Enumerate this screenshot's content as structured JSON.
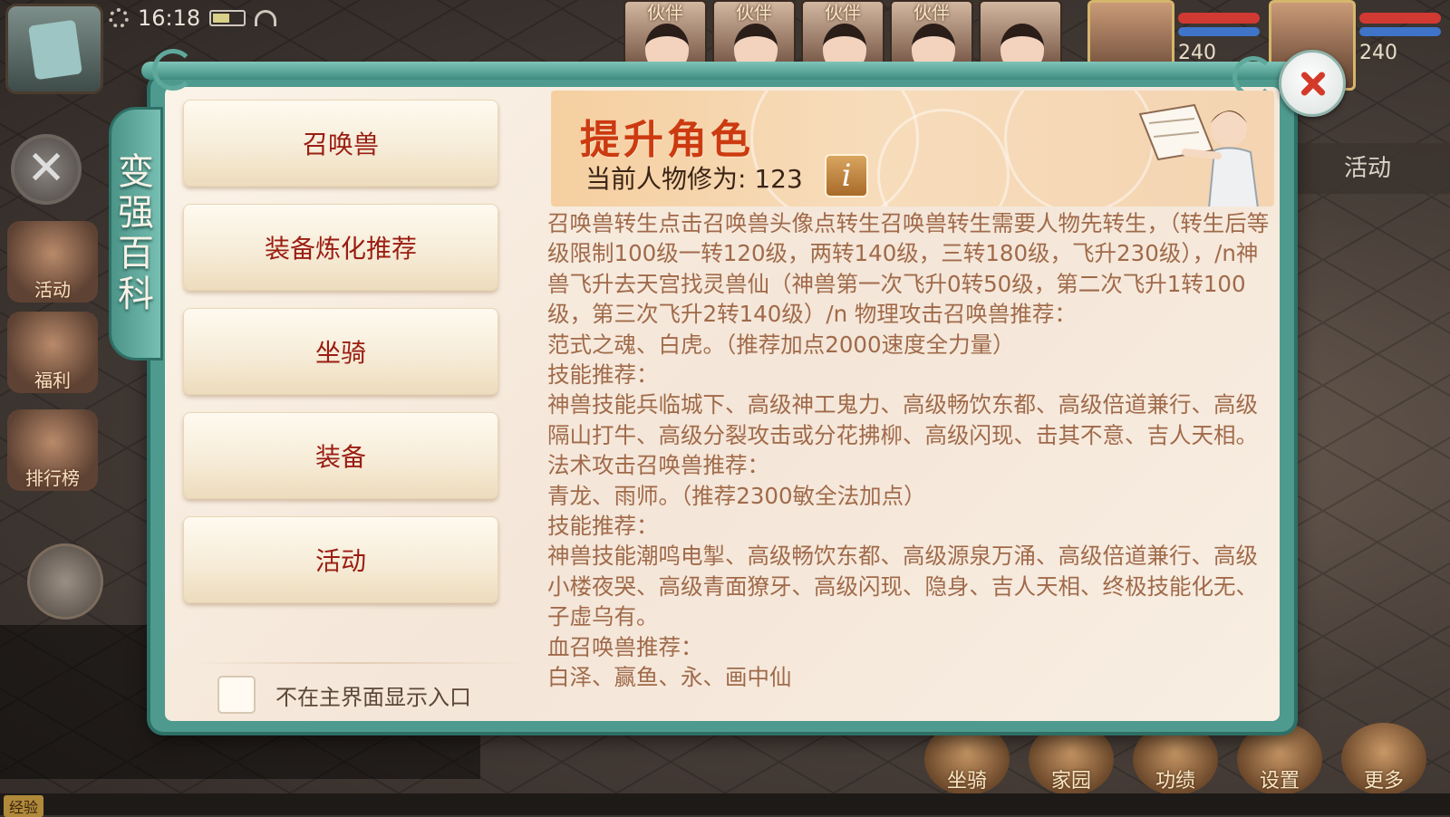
{
  "status": {
    "time": "16:18"
  },
  "hud": {
    "side_icons": [
      "活动",
      "福利",
      "排行榜"
    ],
    "partner_label": "伙伴",
    "hero_hp": [
      "240",
      "240"
    ],
    "activity_tab": "活动",
    "bottom_buttons": [
      "坐骑",
      "家园",
      "功绩",
      "设置",
      "更多"
    ],
    "exp_label": "经验"
  },
  "dialog": {
    "title_chars": [
      "变",
      "强",
      "百",
      "科"
    ],
    "menu": [
      "召唤兽",
      "装备炼化推荐",
      "坐骑",
      "装备",
      "活动"
    ],
    "hide_entry_label": "不在主界面显示入口",
    "banner": {
      "title": "提升角色",
      "level_text": "当前人物修为: 123",
      "info_icon": "i"
    },
    "content": "召唤兽转生点击召唤兽头像点转生召唤兽转生需要人物先转生，（转生后等级限制100级一转120级，两转140级，三转180级，飞升230级），/n神兽飞升去天宫找灵兽仙（神兽第一次飞升0转50级，第二次飞升1转100级，第三次飞升2转140级）/n 物理攻击召唤兽推荐：\n范式之魂、白虎。（推荐加点2000速度全力量）\n技能推荐：\n神兽技能兵临城下、高级神工鬼力、高级畅饮东都、高级倍道兼行、高级隔山打牛、高级分裂攻击或分花拂柳、高级闪现、击其不意、吉人天相。\n法术攻击召唤兽推荐：\n青龙、雨师。（推荐2300敏全法加点）\n技能推荐：\n神兽技能潮鸣电掣、高级畅饮东都、高级源泉万涌、高级倍道兼行、高级小楼夜哭、高级青面獠牙、高级闪现、隐身、吉人天相、终极技能化无、子虚乌有。\n血召唤兽推荐：\n白泽、赢鱼、永、画中仙"
  },
  "colors": {
    "frame_teal": "#4f9a8e",
    "menu_text": "#9a1d12",
    "banner_title": "#cc3a10",
    "content_text": "#a06a4a",
    "close_x": "#d33a2a"
  },
  "icons": [
    "gear-icon",
    "battery-icon",
    "wifi-icon",
    "map-icon",
    "close-icon",
    "chat-icon",
    "info-icon"
  ]
}
